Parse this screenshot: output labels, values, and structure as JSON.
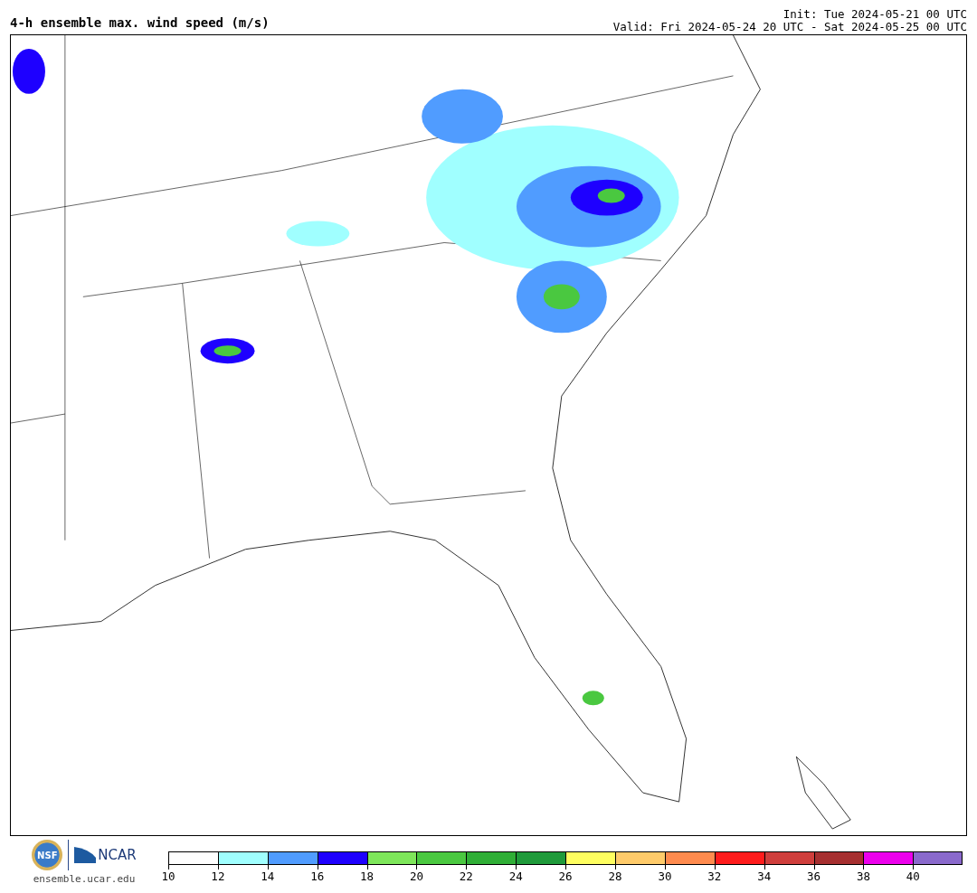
{
  "title": "4-h ensemble max. wind speed (m/s)",
  "init": "Init: Tue 2024-05-21 00 UTC",
  "valid": "Valid: Fri 2024-05-24 20 UTC - Sat 2024-05-25 00 UTC",
  "footer": {
    "nsf_logo": "NSF",
    "ncar_logo": "NCAR",
    "site": "ensemble.ucar.edu"
  },
  "colorbar": [
    {
      "label": "10",
      "color": "#ffffff"
    },
    {
      "label": "12",
      "color": "#a0ffff"
    },
    {
      "label": "14",
      "color": "#509cff"
    },
    {
      "label": "16",
      "color": "#1e00ff"
    },
    {
      "label": "18",
      "color": "#7ee65a"
    },
    {
      "label": "20",
      "color": "#4ac840"
    },
    {
      "label": "22",
      "color": "#2fae36"
    },
    {
      "label": "24",
      "color": "#1f9a3a"
    },
    {
      "label": "26",
      "color": "#ffff60"
    },
    {
      "label": "28",
      "color": "#ffcb6a"
    },
    {
      "label": "30",
      "color": "#ff8b4e"
    },
    {
      "label": "32",
      "color": "#ff1c1c"
    },
    {
      "label": "34",
      "color": "#cf3e3c"
    },
    {
      "label": "36",
      "color": "#a62f30"
    },
    {
      "label": "38",
      "color": "#ec00ec"
    },
    {
      "label": "40",
      "color": "#8a69cc"
    }
  ]
}
